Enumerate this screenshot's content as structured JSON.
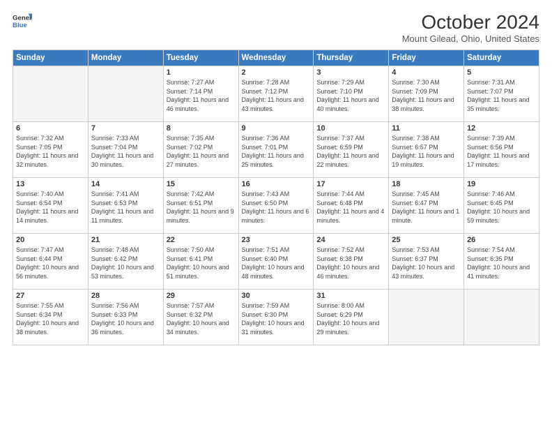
{
  "logo": {
    "line1": "General",
    "line2": "Blue"
  },
  "title": "October 2024",
  "subtitle": "Mount Gilead, Ohio, United States",
  "weekdays": [
    "Sunday",
    "Monday",
    "Tuesday",
    "Wednesday",
    "Thursday",
    "Friday",
    "Saturday"
  ],
  "weeks": [
    [
      {
        "day": "",
        "info": ""
      },
      {
        "day": "",
        "info": ""
      },
      {
        "day": "1",
        "info": "Sunrise: 7:27 AM\nSunset: 7:14 PM\nDaylight: 11 hours and 46 minutes."
      },
      {
        "day": "2",
        "info": "Sunrise: 7:28 AM\nSunset: 7:12 PM\nDaylight: 11 hours and 43 minutes."
      },
      {
        "day": "3",
        "info": "Sunrise: 7:29 AM\nSunset: 7:10 PM\nDaylight: 11 hours and 40 minutes."
      },
      {
        "day": "4",
        "info": "Sunrise: 7:30 AM\nSunset: 7:09 PM\nDaylight: 11 hours and 38 minutes."
      },
      {
        "day": "5",
        "info": "Sunrise: 7:31 AM\nSunset: 7:07 PM\nDaylight: 11 hours and 35 minutes."
      }
    ],
    [
      {
        "day": "6",
        "info": "Sunrise: 7:32 AM\nSunset: 7:05 PM\nDaylight: 11 hours and 32 minutes."
      },
      {
        "day": "7",
        "info": "Sunrise: 7:33 AM\nSunset: 7:04 PM\nDaylight: 11 hours and 30 minutes."
      },
      {
        "day": "8",
        "info": "Sunrise: 7:35 AM\nSunset: 7:02 PM\nDaylight: 11 hours and 27 minutes."
      },
      {
        "day": "9",
        "info": "Sunrise: 7:36 AM\nSunset: 7:01 PM\nDaylight: 11 hours and 25 minutes."
      },
      {
        "day": "10",
        "info": "Sunrise: 7:37 AM\nSunset: 6:59 PM\nDaylight: 11 hours and 22 minutes."
      },
      {
        "day": "11",
        "info": "Sunrise: 7:38 AM\nSunset: 6:57 PM\nDaylight: 11 hours and 19 minutes."
      },
      {
        "day": "12",
        "info": "Sunrise: 7:39 AM\nSunset: 6:56 PM\nDaylight: 11 hours and 17 minutes."
      }
    ],
    [
      {
        "day": "13",
        "info": "Sunrise: 7:40 AM\nSunset: 6:54 PM\nDaylight: 11 hours and 14 minutes."
      },
      {
        "day": "14",
        "info": "Sunrise: 7:41 AM\nSunset: 6:53 PM\nDaylight: 11 hours and 11 minutes."
      },
      {
        "day": "15",
        "info": "Sunrise: 7:42 AM\nSunset: 6:51 PM\nDaylight: 11 hours and 9 minutes."
      },
      {
        "day": "16",
        "info": "Sunrise: 7:43 AM\nSunset: 6:50 PM\nDaylight: 11 hours and 6 minutes."
      },
      {
        "day": "17",
        "info": "Sunrise: 7:44 AM\nSunset: 6:48 PM\nDaylight: 11 hours and 4 minutes."
      },
      {
        "day": "18",
        "info": "Sunrise: 7:45 AM\nSunset: 6:47 PM\nDaylight: 11 hours and 1 minute."
      },
      {
        "day": "19",
        "info": "Sunrise: 7:46 AM\nSunset: 6:45 PM\nDaylight: 10 hours and 59 minutes."
      }
    ],
    [
      {
        "day": "20",
        "info": "Sunrise: 7:47 AM\nSunset: 6:44 PM\nDaylight: 10 hours and 56 minutes."
      },
      {
        "day": "21",
        "info": "Sunrise: 7:48 AM\nSunset: 6:42 PM\nDaylight: 10 hours and 53 minutes."
      },
      {
        "day": "22",
        "info": "Sunrise: 7:50 AM\nSunset: 6:41 PM\nDaylight: 10 hours and 51 minutes."
      },
      {
        "day": "23",
        "info": "Sunrise: 7:51 AM\nSunset: 6:40 PM\nDaylight: 10 hours and 48 minutes."
      },
      {
        "day": "24",
        "info": "Sunrise: 7:52 AM\nSunset: 6:38 PM\nDaylight: 10 hours and 46 minutes."
      },
      {
        "day": "25",
        "info": "Sunrise: 7:53 AM\nSunset: 6:37 PM\nDaylight: 10 hours and 43 minutes."
      },
      {
        "day": "26",
        "info": "Sunrise: 7:54 AM\nSunset: 6:35 PM\nDaylight: 10 hours and 41 minutes."
      }
    ],
    [
      {
        "day": "27",
        "info": "Sunrise: 7:55 AM\nSunset: 6:34 PM\nDaylight: 10 hours and 38 minutes."
      },
      {
        "day": "28",
        "info": "Sunrise: 7:56 AM\nSunset: 6:33 PM\nDaylight: 10 hours and 36 minutes."
      },
      {
        "day": "29",
        "info": "Sunrise: 7:57 AM\nSunset: 6:32 PM\nDaylight: 10 hours and 34 minutes."
      },
      {
        "day": "30",
        "info": "Sunrise: 7:59 AM\nSunset: 6:30 PM\nDaylight: 10 hours and 31 minutes."
      },
      {
        "day": "31",
        "info": "Sunrise: 8:00 AM\nSunset: 6:29 PM\nDaylight: 10 hours and 29 minutes."
      },
      {
        "day": "",
        "info": ""
      },
      {
        "day": "",
        "info": ""
      }
    ]
  ]
}
